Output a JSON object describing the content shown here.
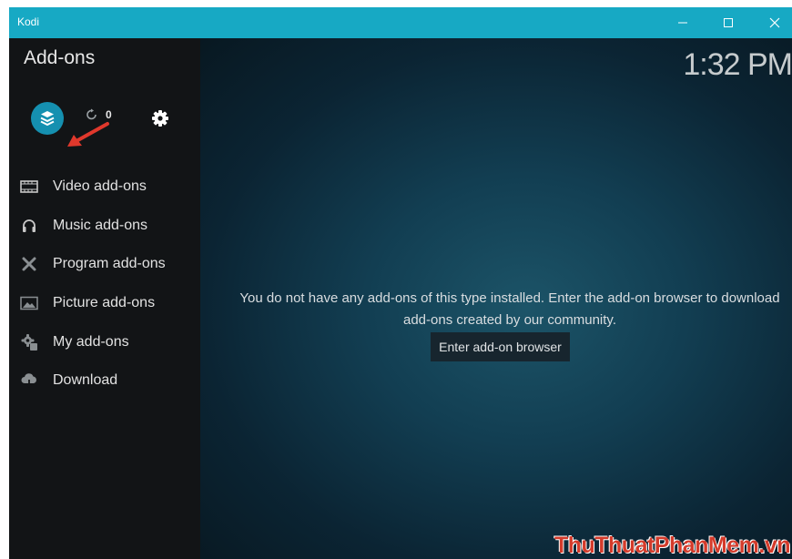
{
  "window": {
    "title": "Kodi",
    "controls": [
      "minimize",
      "maximize",
      "close"
    ]
  },
  "sidebar": {
    "heading": "Add-ons",
    "toolbar": {
      "browser_icon": "addon-browser-icon",
      "update_count": "0",
      "settings_icon": "gear-icon"
    },
    "items": [
      {
        "label": "Video add-ons",
        "icon": "film-icon"
      },
      {
        "label": "Music add-ons",
        "icon": "headphones-icon"
      },
      {
        "label": "Program add-ons",
        "icon": "tools-icon"
      },
      {
        "label": "Picture add-ons",
        "icon": "picture-icon"
      },
      {
        "label": "My add-ons",
        "icon": "cog-box-icon"
      },
      {
        "label": "Download",
        "icon": "cloud-download-icon"
      }
    ]
  },
  "main": {
    "clock": "1:32 PM",
    "message_line1": "You do not have any add-ons of this type installed. Enter the add-on browser to download",
    "message_line2": "add-ons created by our community.",
    "button_label": "Enter add-on browser"
  },
  "watermark": "ThuThuatPhanMem.vn",
  "colors": {
    "titlebar": "#17a9c4",
    "accent": "#1590b0",
    "arrow": "#e0382c"
  }
}
